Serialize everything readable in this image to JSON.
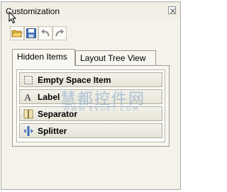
{
  "window": {
    "title": "Customization"
  },
  "toolbar": {
    "buttons": [
      {
        "name": "open",
        "icon": "open-folder-icon"
      },
      {
        "name": "save",
        "icon": "save-icon"
      },
      {
        "name": "undo",
        "icon": "undo-icon"
      },
      {
        "name": "redo",
        "icon": "redo-icon"
      }
    ]
  },
  "tabs": [
    {
      "label": "Hidden Items",
      "active": true
    },
    {
      "label": "Layout Tree View",
      "active": false
    }
  ],
  "hidden_items": [
    {
      "label": "Empty Space Item",
      "icon": "empty-space-icon"
    },
    {
      "label": "Label",
      "icon": "label-icon"
    },
    {
      "label": "Separator",
      "icon": "separator-icon"
    },
    {
      "label": "Splitter",
      "icon": "splitter-icon"
    }
  ],
  "watermark": {
    "text": "慧都控件网",
    "url": "WWW.EVGET.COM"
  },
  "colors": {
    "window_bg": "#f4f2ea",
    "item_border": "#b2af9f",
    "watermark": "#78a0c8",
    "icon_blue": "#3a6fb8"
  }
}
